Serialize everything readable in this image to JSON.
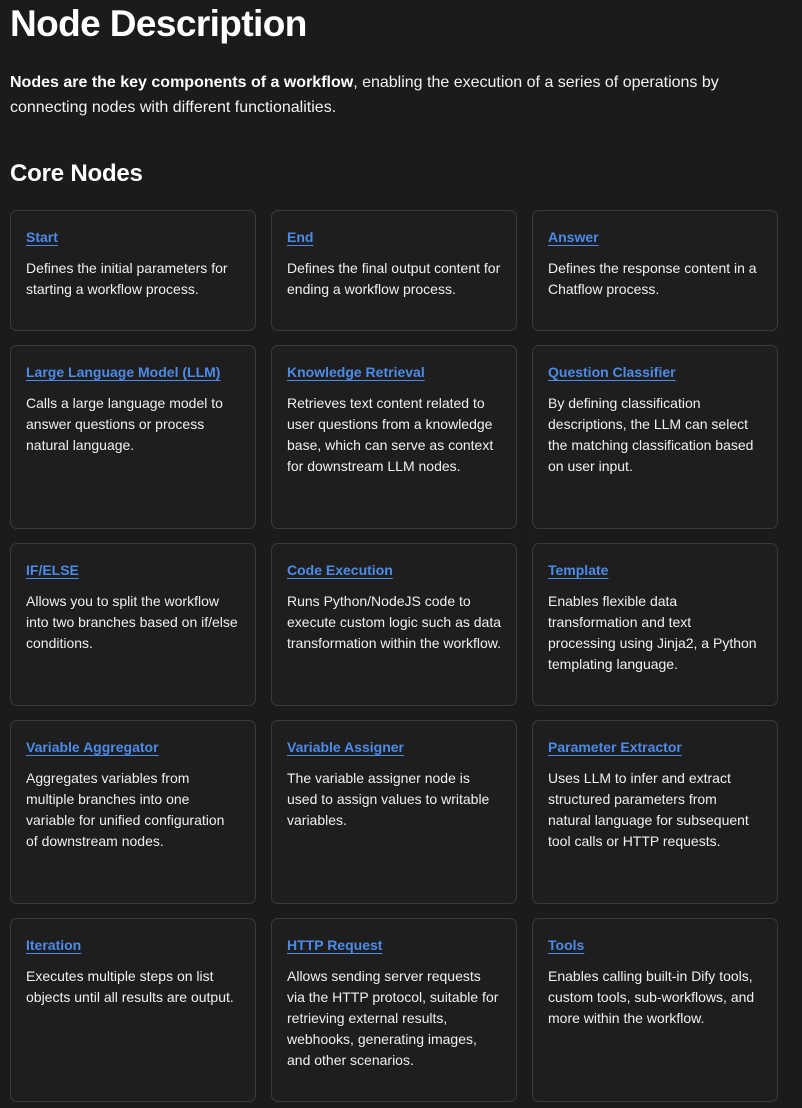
{
  "header": {
    "title": "Node Description",
    "intro_bold": "Nodes are the key components of a workflow",
    "intro_rest": ", enabling the execution of a series of operations by connecting nodes with different functionalities."
  },
  "section": {
    "title": "Core Nodes"
  },
  "colors": {
    "background": "#1b1b1c",
    "link": "#4c8be8",
    "card_border": "#3a3a3c"
  },
  "cards": [
    {
      "title": "Start",
      "description": "Defines the initial parameters for starting a workflow process."
    },
    {
      "title": "End",
      "description": "Defines the final output content for ending a workflow process."
    },
    {
      "title": "Answer",
      "description": "Defines the response content in a Chatflow process."
    },
    {
      "title": "Large Language Model (LLM)",
      "description": "Calls a large language model to answer questions or process natural language."
    },
    {
      "title": "Knowledge Retrieval",
      "description": "Retrieves text content related to user questions from a knowledge base, which can serve as context for downstream LLM nodes."
    },
    {
      "title": "Question Classifier",
      "description": "By defining classification descriptions, the LLM can select the matching classification based on user input."
    },
    {
      "title": "IF/ELSE",
      "description": "Allows you to split the workflow into two branches based on if/else conditions."
    },
    {
      "title": "Code Execution",
      "description": "Runs Python/NodeJS code to execute custom logic such as data transformation within the workflow."
    },
    {
      "title": "Template",
      "description": "Enables flexible data transformation and text processing using Jinja2, a Python templating language."
    },
    {
      "title": "Variable Aggregator",
      "description": "Aggregates variables from multiple branches into one variable for unified configuration of downstream nodes."
    },
    {
      "title": "Variable Assigner",
      "description": "The variable assigner node is used to assign values to writable variables."
    },
    {
      "title": "Parameter Extractor",
      "description": "Uses LLM to infer and extract structured parameters from natural language for subsequent tool calls or HTTP requests."
    },
    {
      "title": "Iteration",
      "description": "Executes multiple steps on list objects until all results are output."
    },
    {
      "title": "HTTP Request",
      "description": "Allows sending server requests via the HTTP protocol, suitable for retrieving external results, webhooks, generating images, and other scenarios."
    },
    {
      "title": "Tools",
      "description": "Enables calling built-in Dify tools, custom tools, sub-workflows, and more within the workflow."
    }
  ]
}
